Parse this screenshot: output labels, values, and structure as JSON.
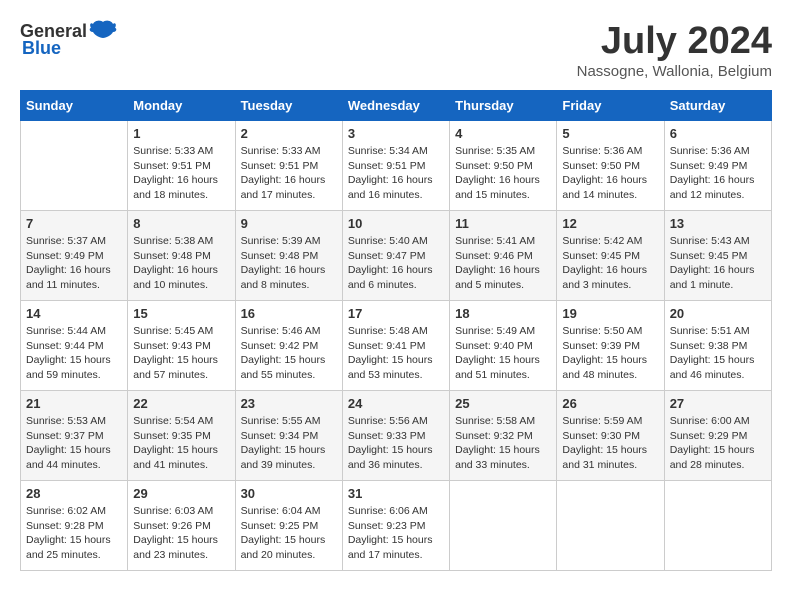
{
  "header": {
    "logo_general": "General",
    "logo_blue": "Blue",
    "month_year": "July 2024",
    "location": "Nassogne, Wallonia, Belgium"
  },
  "calendar": {
    "days_of_week": [
      "Sunday",
      "Monday",
      "Tuesday",
      "Wednesday",
      "Thursday",
      "Friday",
      "Saturday"
    ],
    "weeks": [
      [
        {
          "day": "",
          "content": ""
        },
        {
          "day": "1",
          "content": "Sunrise: 5:33 AM\nSunset: 9:51 PM\nDaylight: 16 hours\nand 18 minutes."
        },
        {
          "day": "2",
          "content": "Sunrise: 5:33 AM\nSunset: 9:51 PM\nDaylight: 16 hours\nand 17 minutes."
        },
        {
          "day": "3",
          "content": "Sunrise: 5:34 AM\nSunset: 9:51 PM\nDaylight: 16 hours\nand 16 minutes."
        },
        {
          "day": "4",
          "content": "Sunrise: 5:35 AM\nSunset: 9:50 PM\nDaylight: 16 hours\nand 15 minutes."
        },
        {
          "day": "5",
          "content": "Sunrise: 5:36 AM\nSunset: 9:50 PM\nDaylight: 16 hours\nand 14 minutes."
        },
        {
          "day": "6",
          "content": "Sunrise: 5:36 AM\nSunset: 9:49 PM\nDaylight: 16 hours\nand 12 minutes."
        }
      ],
      [
        {
          "day": "7",
          "content": "Sunrise: 5:37 AM\nSunset: 9:49 PM\nDaylight: 16 hours\nand 11 minutes."
        },
        {
          "day": "8",
          "content": "Sunrise: 5:38 AM\nSunset: 9:48 PM\nDaylight: 16 hours\nand 10 minutes."
        },
        {
          "day": "9",
          "content": "Sunrise: 5:39 AM\nSunset: 9:48 PM\nDaylight: 16 hours\nand 8 minutes."
        },
        {
          "day": "10",
          "content": "Sunrise: 5:40 AM\nSunset: 9:47 PM\nDaylight: 16 hours\nand 6 minutes."
        },
        {
          "day": "11",
          "content": "Sunrise: 5:41 AM\nSunset: 9:46 PM\nDaylight: 16 hours\nand 5 minutes."
        },
        {
          "day": "12",
          "content": "Sunrise: 5:42 AM\nSunset: 9:45 PM\nDaylight: 16 hours\nand 3 minutes."
        },
        {
          "day": "13",
          "content": "Sunrise: 5:43 AM\nSunset: 9:45 PM\nDaylight: 16 hours\nand 1 minute."
        }
      ],
      [
        {
          "day": "14",
          "content": "Sunrise: 5:44 AM\nSunset: 9:44 PM\nDaylight: 15 hours\nand 59 minutes."
        },
        {
          "day": "15",
          "content": "Sunrise: 5:45 AM\nSunset: 9:43 PM\nDaylight: 15 hours\nand 57 minutes."
        },
        {
          "day": "16",
          "content": "Sunrise: 5:46 AM\nSunset: 9:42 PM\nDaylight: 15 hours\nand 55 minutes."
        },
        {
          "day": "17",
          "content": "Sunrise: 5:48 AM\nSunset: 9:41 PM\nDaylight: 15 hours\nand 53 minutes."
        },
        {
          "day": "18",
          "content": "Sunrise: 5:49 AM\nSunset: 9:40 PM\nDaylight: 15 hours\nand 51 minutes."
        },
        {
          "day": "19",
          "content": "Sunrise: 5:50 AM\nSunset: 9:39 PM\nDaylight: 15 hours\nand 48 minutes."
        },
        {
          "day": "20",
          "content": "Sunrise: 5:51 AM\nSunset: 9:38 PM\nDaylight: 15 hours\nand 46 minutes."
        }
      ],
      [
        {
          "day": "21",
          "content": "Sunrise: 5:53 AM\nSunset: 9:37 PM\nDaylight: 15 hours\nand 44 minutes."
        },
        {
          "day": "22",
          "content": "Sunrise: 5:54 AM\nSunset: 9:35 PM\nDaylight: 15 hours\nand 41 minutes."
        },
        {
          "day": "23",
          "content": "Sunrise: 5:55 AM\nSunset: 9:34 PM\nDaylight: 15 hours\nand 39 minutes."
        },
        {
          "day": "24",
          "content": "Sunrise: 5:56 AM\nSunset: 9:33 PM\nDaylight: 15 hours\nand 36 minutes."
        },
        {
          "day": "25",
          "content": "Sunrise: 5:58 AM\nSunset: 9:32 PM\nDaylight: 15 hours\nand 33 minutes."
        },
        {
          "day": "26",
          "content": "Sunrise: 5:59 AM\nSunset: 9:30 PM\nDaylight: 15 hours\nand 31 minutes."
        },
        {
          "day": "27",
          "content": "Sunrise: 6:00 AM\nSunset: 9:29 PM\nDaylight: 15 hours\nand 28 minutes."
        }
      ],
      [
        {
          "day": "28",
          "content": "Sunrise: 6:02 AM\nSunset: 9:28 PM\nDaylight: 15 hours\nand 25 minutes."
        },
        {
          "day": "29",
          "content": "Sunrise: 6:03 AM\nSunset: 9:26 PM\nDaylight: 15 hours\nand 23 minutes."
        },
        {
          "day": "30",
          "content": "Sunrise: 6:04 AM\nSunset: 9:25 PM\nDaylight: 15 hours\nand 20 minutes."
        },
        {
          "day": "31",
          "content": "Sunrise: 6:06 AM\nSunset: 9:23 PM\nDaylight: 15 hours\nand 17 minutes."
        },
        {
          "day": "",
          "content": ""
        },
        {
          "day": "",
          "content": ""
        },
        {
          "day": "",
          "content": ""
        }
      ]
    ]
  }
}
